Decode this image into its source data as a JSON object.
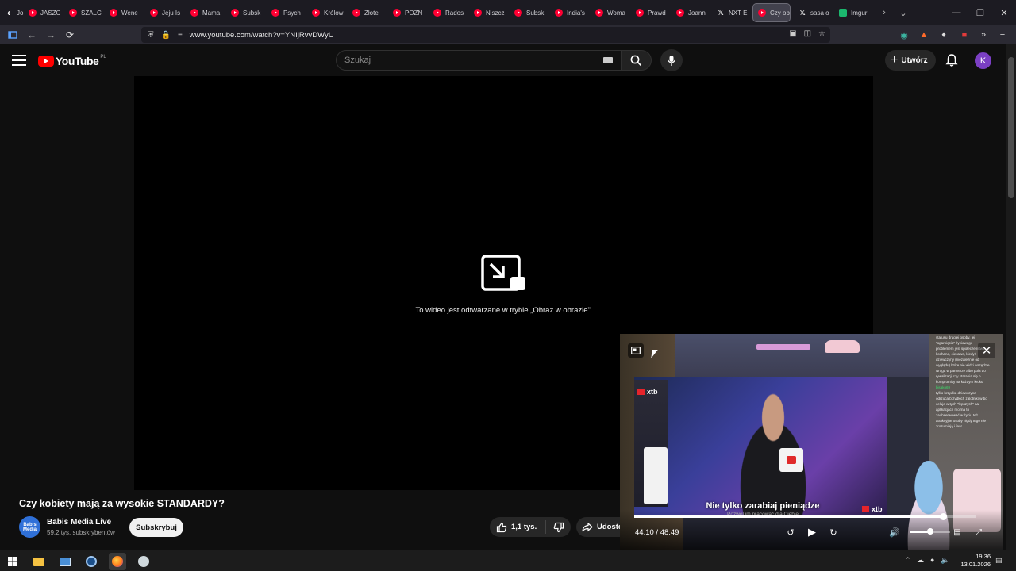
{
  "browser": {
    "tabs": [
      {
        "label": "Jo",
        "icon": "chevron-left-icon",
        "kind": "nav"
      },
      {
        "label": "JASZC",
        "icon": "youtube-favicon",
        "kind": "yt"
      },
      {
        "label": "SZALC",
        "icon": "youtube-favicon",
        "kind": "yt"
      },
      {
        "label": "Wene",
        "icon": "youtube-favicon",
        "kind": "yt"
      },
      {
        "label": "Jeju Is",
        "icon": "youtube-favicon",
        "kind": "yt"
      },
      {
        "label": "Mama",
        "icon": "youtube-favicon",
        "kind": "yt"
      },
      {
        "label": "Subsk",
        "icon": "youtube-favicon",
        "kind": "yt"
      },
      {
        "label": "Psych",
        "icon": "youtube-favicon",
        "kind": "yt"
      },
      {
        "label": "Królow",
        "icon": "youtube-favicon",
        "kind": "yt"
      },
      {
        "label": "Złote",
        "icon": "youtube-favicon",
        "kind": "yt"
      },
      {
        "label": "POZN",
        "icon": "youtube-favicon",
        "kind": "yt"
      },
      {
        "label": "Rados",
        "icon": "youtube-favicon",
        "kind": "yt"
      },
      {
        "label": "Niszcz",
        "icon": "youtube-favicon",
        "kind": "yt"
      },
      {
        "label": "Subsk",
        "icon": "youtube-favicon",
        "kind": "yt"
      },
      {
        "label": "India's",
        "icon": "youtube-favicon",
        "kind": "yt"
      },
      {
        "label": "Woma",
        "icon": "youtube-favicon",
        "kind": "yt"
      },
      {
        "label": "Prawd",
        "icon": "youtube-favicon",
        "kind": "yt"
      },
      {
        "label": "Joann",
        "icon": "youtube-favicon",
        "kind": "yt"
      },
      {
        "label": "NXT E",
        "icon": "x-favicon",
        "kind": "x"
      },
      {
        "label": "Czy obi",
        "icon": "youtube-favicon",
        "kind": "yt",
        "active": true
      },
      {
        "label": "sasa o",
        "icon": "x-favicon",
        "kind": "x"
      },
      {
        "label": "Imgur",
        "icon": "imgur-favicon",
        "kind": "img"
      }
    ],
    "url": "www.youtube.com/watch?v=YNIjRvvDWyU"
  },
  "youtube": {
    "logo_text": "YouTube",
    "region": "PL",
    "search_placeholder": "Szukaj",
    "create_label": "Utwórz",
    "avatar_letter": "K"
  },
  "player": {
    "pip_message": "To wideo jest odtwarzane w trybie „Obraz w obrazie\"."
  },
  "video": {
    "title": "Czy kobiety mają za wysokie STANDARDY?",
    "channel_name": "Babis Media Live",
    "channel_avatar_text": "Babis Media",
    "subscribers": "59,2 tys. subskrybentów",
    "subscribe_label": "Subskrybuj",
    "likes": "1,1 tys.",
    "share_label": "Udostę"
  },
  "pip": {
    "current_time": "44:10",
    "duration": "48:49",
    "time_display": "44:10 / 48:49",
    "progress": 0.9047,
    "volume": 0.5,
    "subtitle_main": "Nie tylko zarabiaj pieniądze",
    "subtitle_small": "Pozwól im pracować dla Ciebie",
    "brand": "xtb",
    "chat_lines": [
      "statusu drugiej osoby, jej",
      "\"ogarnięcia\" życiowego",
      "problemem jest społeczeństwo",
      "kochane, ciekawe, kiedyś",
      "dziewczyny (niezależnie od",
      "wyglądu) które nie widzi wszędzie",
      "wroga w partnerze albo pola do",
      "rywalizacji czy starania się o",
      "kompromisy na każdym kroku",
      "tylko brzydka dziewczyna",
      "odrzuca brzydkich zalotników bo",
      "celuje w tych \"lepszych\" na",
      "aplikacjach można to",
      "zaobserwować w życiu też",
      "atrakcyjne osoby nigdy tego nie",
      "zrozumieją i fear"
    ],
    "chat_user": "bisako69"
  },
  "taskbar": {
    "time": "19:36",
    "date": "13.01.2026"
  },
  "colors": {
    "youtube_red": "#ff0000",
    "avatar": "#7b3fc4",
    "bg": "#0f0f0f"
  }
}
